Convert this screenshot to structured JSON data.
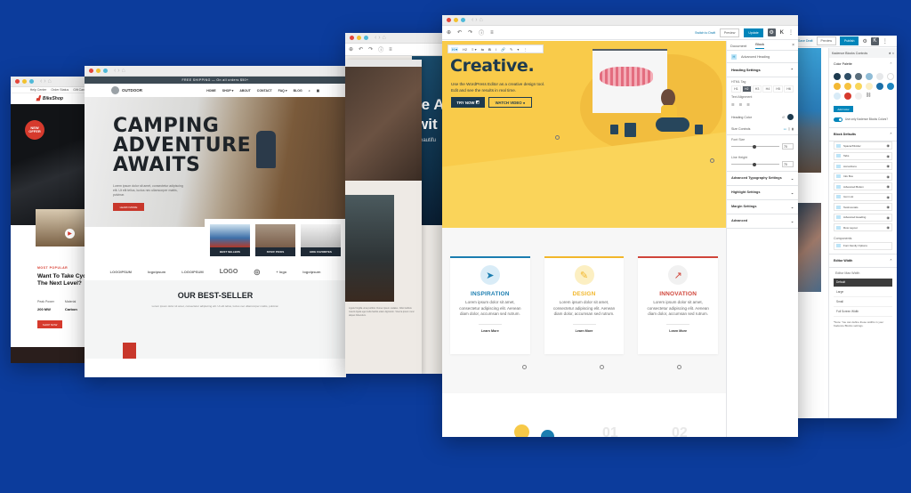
{
  "background_color": "#0c3c9c",
  "windows": {
    "bikeshop": {
      "top_links": [
        "Help Center",
        "Order Status",
        "Gift Cards"
      ],
      "brand": "BikeShop",
      "badge": "NEW OFFER",
      "kicker": "MOST POPULAR",
      "title_line1": "Want To Take Cyc",
      "title_line2": "The Next Level?",
      "spec1_label": "Peak Power",
      "spec1_value": "200 MW",
      "spec2_label": "Material",
      "spec2_value": "Carbon",
      "button": "SHOP NOW"
    },
    "outdoor": {
      "shipping_bar": "FREE SHIPPING — On all orders $50+",
      "logo": "OUTDOOR",
      "menu": [
        "HOME",
        "SHOP ▾",
        "ABOUT",
        "CONTACT",
        "FAQ ▾",
        "BLOG"
      ],
      "hero_line1": "CAMPING",
      "hero_line2": "ADVENTURE",
      "hero_line3": "AWAITS",
      "hero_text": "Lorem ipsum dolor sit amet, consectetur adipiscing elit. Ut elit tellus, luctus nec ullamcorper mattis, pulvinar.",
      "hero_button": "LEARN MORE",
      "categories": [
        "BEST SELLERS",
        "STAFF PICKS",
        "HIKE FAVORITES"
      ],
      "partner_logos": [
        "LOGOIPSUM",
        "logoipsum",
        "LOGOIPSUM",
        "LOGO",
        "◎",
        "+ logo",
        "logoipsum"
      ],
      "bestseller_title": "OUR BEST-SELLER",
      "bestseller_text": "Lorem ipsum dolor sit amet, consectetur adipiscing elit. Ut elit tellus, luctus nec ullamcorper mattis, pulvinar."
    },
    "middle": {
      "overlay_line1": "te A",
      "overlay_line2": "wit",
      "overlay_sub": "Beautifu",
      "caption": "Ligula fringilla urna porttitor. Donec ipsum sodales. Odio facilisis mauris ligula eget nulla facilisi etiam dignissim. Viverra ipsum nunc aliquet bibendum."
    },
    "editor": {
      "toolbar": {
        "switch_to_draft": "Switch to Draft",
        "preview": "Preview",
        "update": "Update"
      },
      "block_toolbar": [
        "H ▾",
        "H2",
        "≡ ▾",
        "⇆",
        "B",
        "I",
        "🔗",
        "✎",
        "▾",
        "⋮"
      ],
      "hero": {
        "heading": "Creative.",
        "text_line1": "Use the WordPress Editor as a creative design tool.",
        "text_line2": "Edit and see the results in real time.",
        "btn_try": "TRY NOW",
        "btn_watch": "WATCH VIDEO"
      },
      "cards": [
        {
          "title": "INSPIRATION",
          "color": "#1b7db0",
          "icon_bg": "#d9ecf7",
          "icon": "paper-plane",
          "text": "Lorem ipsum dolor sit amet, consectetur adipiscing elit. Aenean diam dolor, accumsan sed rutrum.",
          "link": "Learn More"
        },
        {
          "title": "DESIGN",
          "color": "#f2b72b",
          "icon_bg": "#fcefc2",
          "icon": "pencil-ruler",
          "text": "Lorem ipsum dolor sit amet, consectetur adipiscing elit. Aenean diam dolor, accumsan sed rutrum.",
          "link": "Learn More"
        },
        {
          "title": "INNOVATION",
          "color": "#d0453a",
          "icon_bg": "#f1f1f1",
          "icon": "chart-line",
          "text": "Lorem ipsum dolor sit amet, consectetur adipiscing elit. Aenean diam dolor, accumsan sed rutrum.",
          "link": "Learn More"
        }
      ],
      "bottom_numbers": [
        "01",
        "02"
      ],
      "sidebar": {
        "tabs": [
          "Document",
          "Block"
        ],
        "block_name": "Advanced Heading",
        "heading_settings": "Heading Settings",
        "html_tag_label": "HTML Tag",
        "html_tags": [
          "H1",
          "H2",
          "H3",
          "H4",
          "H5",
          "H6"
        ],
        "html_tag_selected": "H2",
        "text_alignment_label": "Text Alignment",
        "heading_color_label": "Heading Color",
        "heading_color": "#1d3a4e",
        "size_controls_label": "Size Controls",
        "font_size_label": "Font Size",
        "font_size_value": "70",
        "line_height_label": "Line Height",
        "line_height_value": "70",
        "collapsed_sections": [
          "Advanced Typography Settings",
          "Highlight Settings",
          "Margin Settings",
          "Advanced"
        ]
      }
    },
    "kadence": {
      "toolbar": {
        "save_draft": "Save Draft",
        "preview": "Preview",
        "publish": "Publish"
      },
      "panel_title": "Kadence Blocks Controls",
      "color_palette_label": "Color Palette",
      "palette": [
        "#1d3a4e",
        "#2f4e66",
        "#5a6e7c",
        "#8fbcd6",
        "#e6e8ea",
        "#ffffff",
        "#f3b833",
        "#f6c23f",
        "#f8d65a",
        "#fbeec2",
        "#1b6fa8",
        "#1f86c0",
        "#d8ebf7",
        "#d63a2d",
        "#efefef"
      ],
      "add_color": "Add Color",
      "toggle_label": "Use only Kadence Blocks Colors?",
      "block_defaults_label": "Block Defaults",
      "blocks": [
        "Spacer/Divider",
        "Tabs",
        "Accordions",
        "Info Box",
        "Advanced Button",
        "Icon List",
        "Testimonials",
        "Advanced Heading",
        "Row Layout"
      ],
      "components_label": "Components",
      "components": [
        "Font Family Options"
      ],
      "editor_width_label": "Editor Width",
      "editor_max_width_label": "Editor Max Width",
      "width_options": [
        "Default",
        "Large",
        "Small",
        "Full Screen Width"
      ],
      "width_selected": "Default",
      "note": "*Note: You can define these widths in your Kadence Blocks settings."
    }
  }
}
